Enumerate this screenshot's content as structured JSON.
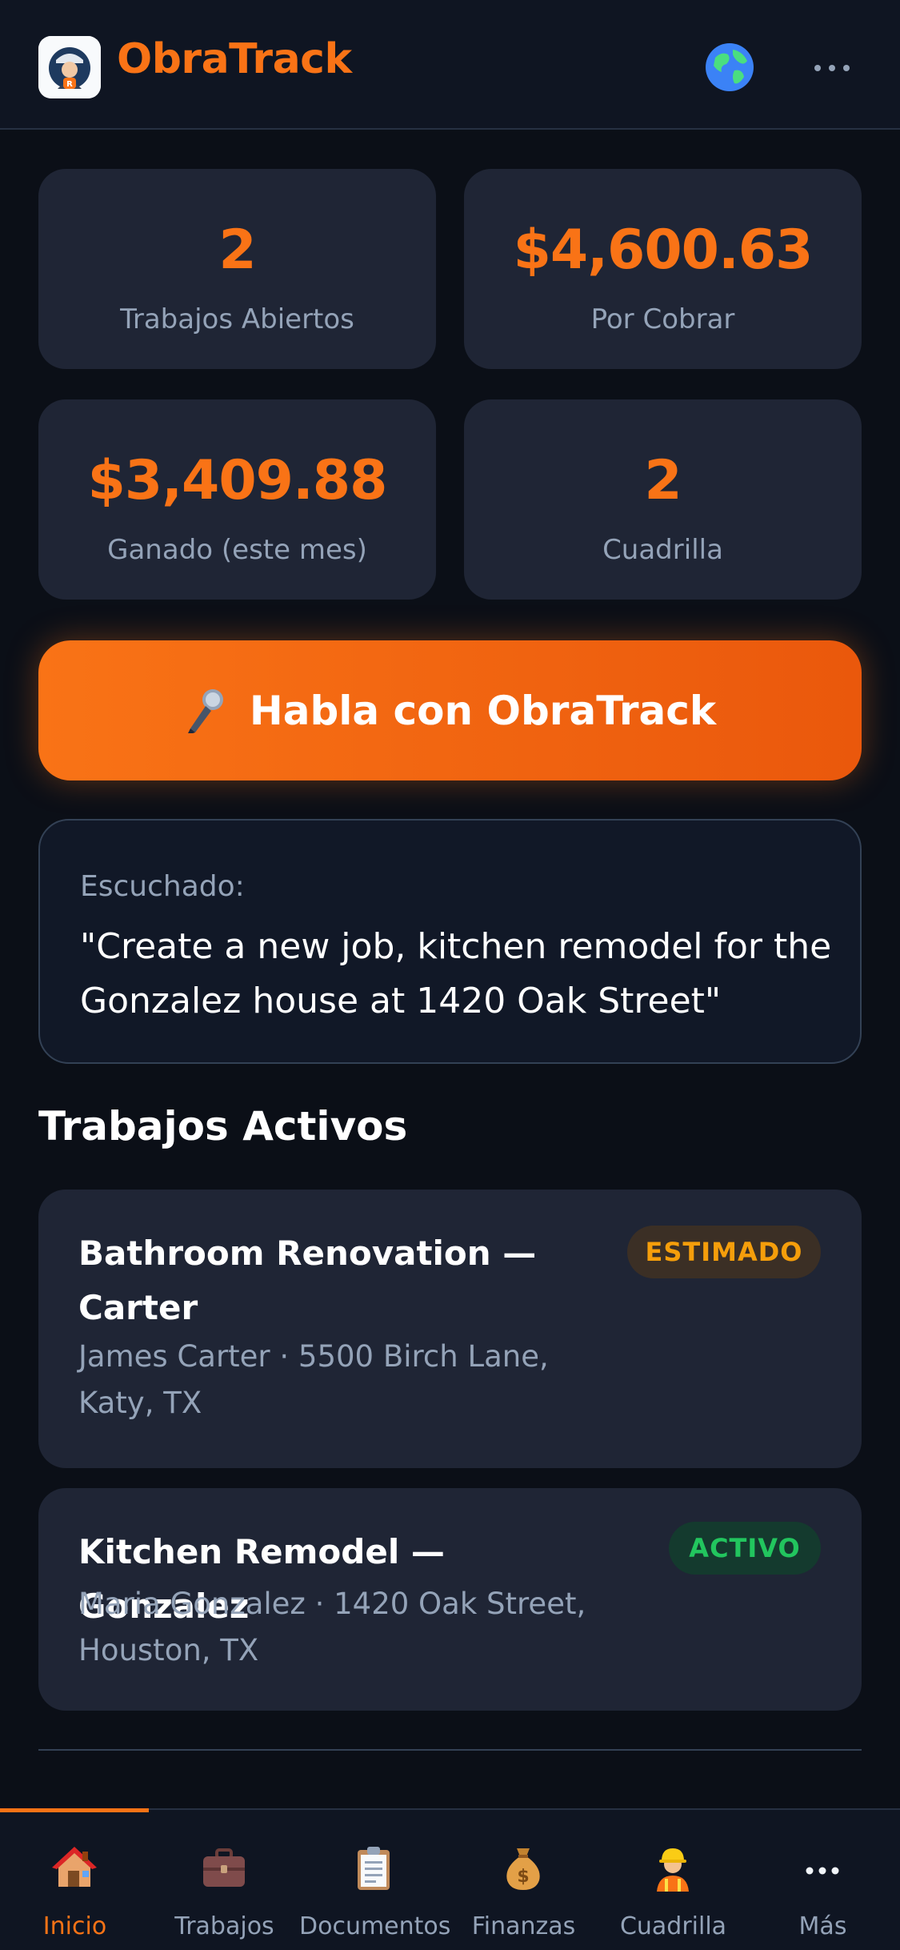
{
  "header": {
    "title": "ObraTrack"
  },
  "stats": [
    {
      "value": "2",
      "label": "Trabajos Abiertos"
    },
    {
      "value": "$4,600.63",
      "label": "Por Cobrar"
    },
    {
      "value": "$3,409.88",
      "label": "Ganado (este mes)"
    },
    {
      "value": "2",
      "label": "Cuadrilla"
    }
  ],
  "voice_button": {
    "label": "Habla con ObraTrack"
  },
  "heard": {
    "caption": "Escuchado:",
    "transcript": "\"Create a new job, kitchen remodel for the Gonzalez house at 1420 Oak Street\""
  },
  "section_title": "Trabajos Activos",
  "jobs": [
    {
      "title": "Bathroom Renovation — Carter",
      "meta": "James Carter · 5500 Birch Lane, Katy, TX",
      "status": "ESTIMADO"
    },
    {
      "title": "Kitchen Remodel — Gonzalez",
      "meta": "Maria Gonzalez · 1420 Oak Street, Houston, TX",
      "status": "ACTIVO"
    }
  ],
  "nav": [
    {
      "label": "Inicio",
      "icon": "house-icon",
      "active": true
    },
    {
      "label": "Trabajos",
      "icon": "briefcase-icon"
    },
    {
      "label": "Documentos",
      "icon": "clipboard-icon"
    },
    {
      "label": "Finanzas",
      "icon": "money-bag-icon"
    },
    {
      "label": "Cuadrilla",
      "icon": "construction-worker-icon"
    },
    {
      "label": "Más",
      "icon": "more-icon"
    }
  ],
  "colors": {
    "accent": "#f97316",
    "background": "#0b0f17",
    "card": "#1f2535",
    "estimado": "#f59e0b",
    "activo": "#22c55e"
  }
}
